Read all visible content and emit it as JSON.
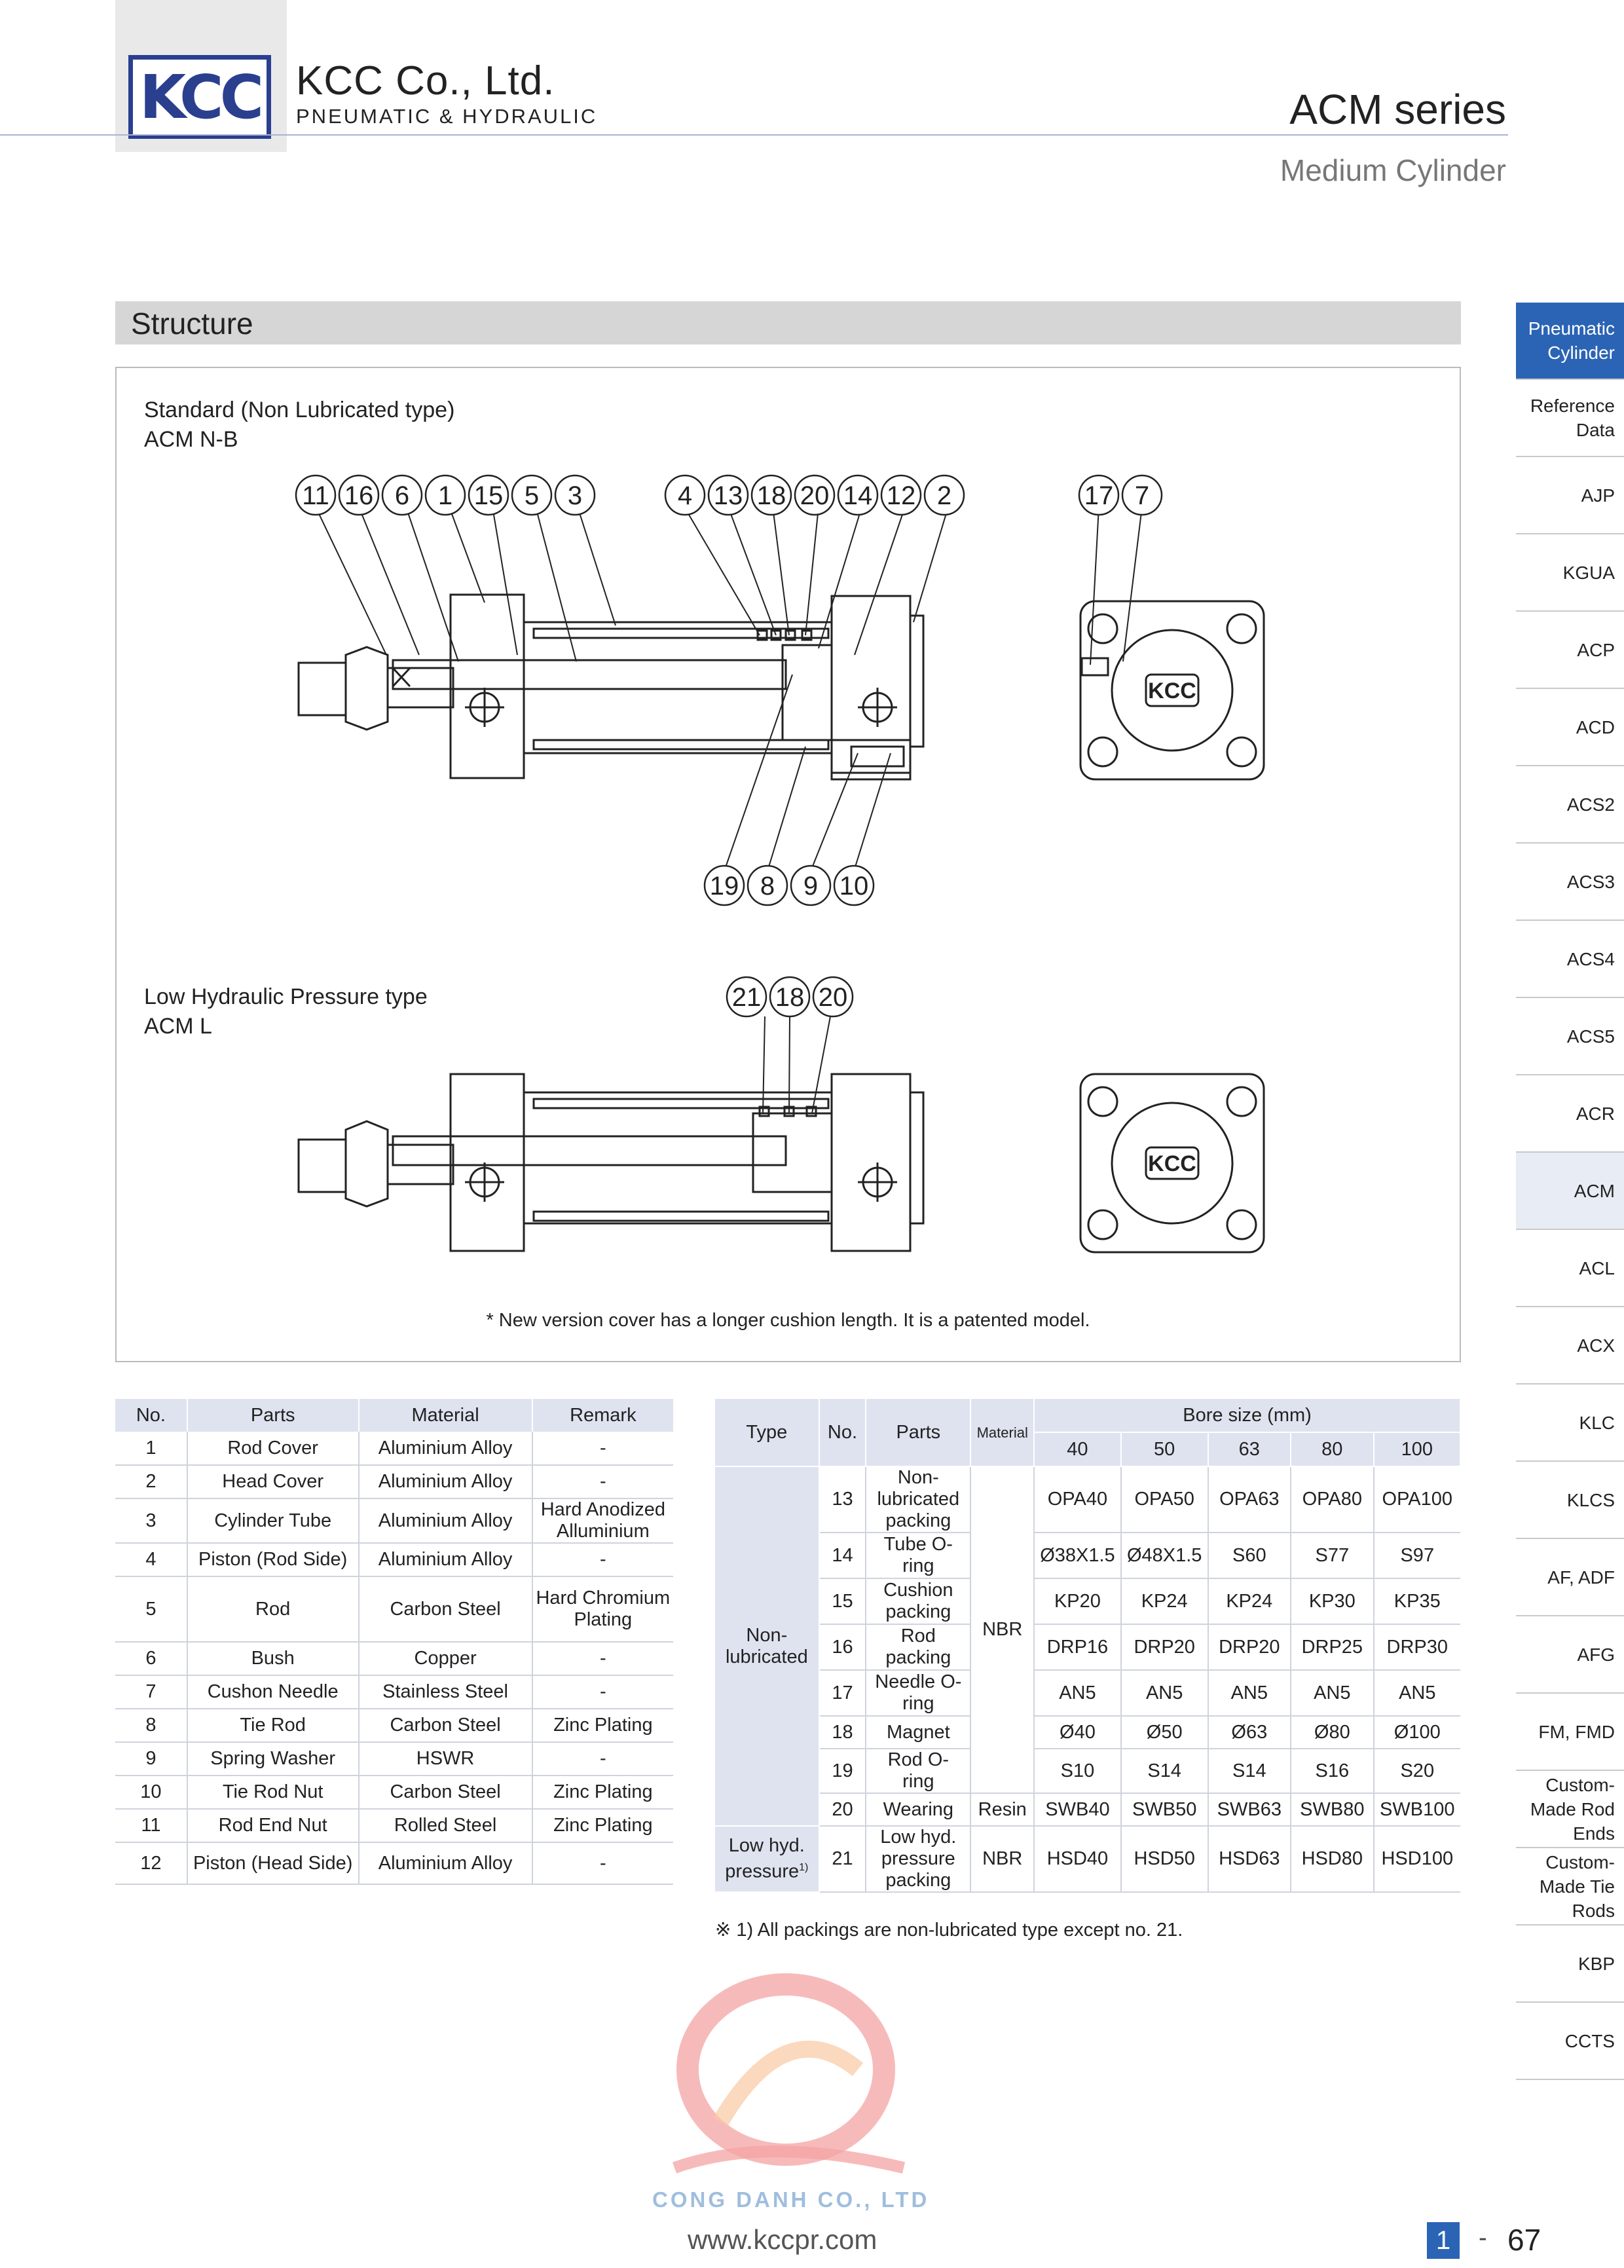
{
  "header": {
    "logo_text": "KCC",
    "company": "KCC Co., Ltd.",
    "company_sub": "PNEUMATIC & HYDRAULIC",
    "series": "ACM series",
    "series_sub": "Medium Cylinder"
  },
  "section": {
    "title": "Structure"
  },
  "structure": {
    "standard_caption_1": "Standard (Non Lubricated type)",
    "standard_caption_2": "ACM N-B",
    "top_callouts_a": [
      "11",
      "16",
      "6",
      "1",
      "15",
      "5",
      "3"
    ],
    "top_callouts_b": [
      "4",
      "13",
      "18",
      "20",
      "14",
      "12",
      "2"
    ],
    "end_callouts": [
      "17",
      "7"
    ],
    "bottom_callouts": [
      "19",
      "8",
      "9",
      "10"
    ],
    "low_caption_1": "Low Hydraulic Pressure type",
    "low_caption_2": "ACM L",
    "low_callouts": [
      "21",
      "18",
      "20"
    ],
    "end_logo": "KCC",
    "note": "* New version cover has a longer cushion length. It is a patented model."
  },
  "parts_table": {
    "headers": [
      "No.",
      "Parts",
      "Material",
      "Remark"
    ],
    "rows": [
      [
        "1",
        "Rod Cover",
        "Aluminium Alloy",
        "-"
      ],
      [
        "2",
        "Head Cover",
        "Aluminium Alloy",
        "-"
      ],
      [
        "3",
        "Cylinder Tube",
        "Aluminium Alloy",
        "Hard Anodized Alluminium"
      ],
      [
        "4",
        "Piston (Rod Side)",
        "Aluminium Alloy",
        "-"
      ],
      [
        "5",
        "Rod",
        "Carbon Steel",
        "Hard Chromium Plating"
      ],
      [
        "6",
        "Bush",
        "Copper",
        "-"
      ],
      [
        "7",
        "Cushon Needle",
        "Stainless Steel",
        "-"
      ],
      [
        "8",
        "Tie Rod",
        "Carbon Steel",
        "Zinc Plating"
      ],
      [
        "9",
        "Spring Washer",
        "HSWR",
        "-"
      ],
      [
        "10",
        "Tie Rod Nut",
        "Carbon Steel",
        "Zinc Plating"
      ],
      [
        "11",
        "Rod End Nut",
        "Rolled Steel",
        "Zinc Plating"
      ],
      [
        "12",
        "Piston (Head Side)",
        "Aluminium Alloy",
        "-"
      ]
    ]
  },
  "seal_table": {
    "h_type": "Type",
    "h_no": "No.",
    "h_parts": "Parts",
    "h_material": "Material",
    "h_bore": "Bore size (mm)",
    "bores": [
      "40",
      "50",
      "63",
      "80",
      "100"
    ],
    "type_nonlub": "Non-lubricated",
    "type_low": "Low hyd. pressure",
    "type_low_sup": "1)",
    "nbr": "NBR",
    "rows": [
      {
        "no": "13",
        "part": "Non-lubricated packing",
        "vals": [
          "OPA40",
          "OPA50",
          "OPA63",
          "OPA80",
          "OPA100"
        ]
      },
      {
        "no": "14",
        "part": "Tube O-ring",
        "vals": [
          "Ø38X1.5",
          "Ø48X1.5",
          "S60",
          "S77",
          "S97"
        ]
      },
      {
        "no": "15",
        "part": "Cushion packing",
        "vals": [
          "KP20",
          "KP24",
          "KP24",
          "KP30",
          "KP35"
        ]
      },
      {
        "no": "16",
        "part": "Rod packing",
        "vals": [
          "DRP16",
          "DRP20",
          "DRP20",
          "DRP25",
          "DRP30"
        ]
      },
      {
        "no": "17",
        "part": "Needle O-ring",
        "vals": [
          "AN5",
          "AN5",
          "AN5",
          "AN5",
          "AN5"
        ]
      },
      {
        "no": "18",
        "part": "Magnet",
        "vals": [
          "Ø40",
          "Ø50",
          "Ø63",
          "Ø80",
          "Ø100"
        ]
      },
      {
        "no": "19",
        "part": "Rod O-ring",
        "vals": [
          "S10",
          "S14",
          "S14",
          "S16",
          "S20"
        ]
      },
      {
        "no": "20",
        "part": "Wearing",
        "material": "Resin",
        "vals": [
          "SWB40",
          "SWB50",
          "SWB63",
          "SWB80",
          "SWB100"
        ]
      },
      {
        "no": "21",
        "part": "Low hyd. pressure packing",
        "material": "NBR",
        "vals": [
          "HSD40",
          "HSD50",
          "HSD63",
          "HSD80",
          "HSD100"
        ]
      }
    ],
    "footnote": "※ 1) All packings are non-lubricated type except no. 21."
  },
  "nav": {
    "items": [
      "Pneumatic Cylinder",
      "Reference Data",
      "AJP",
      "KGUA",
      "ACP",
      "ACD",
      "ACS2",
      "ACS3",
      "ACS4",
      "ACS5",
      "ACR",
      "ACM",
      "ACL",
      "ACX",
      "KLC",
      "KLCS",
      "AF, ADF",
      "AFG",
      "FM, FMD",
      "Custom-Made Rod Ends",
      "Custom-Made Tie Rods",
      "KBP",
      "CCTS"
    ],
    "active": "Pneumatic Cylinder",
    "current": "ACM"
  },
  "footer": {
    "watermark": "CONG DANH CO., LTD",
    "url": "www.kccpr.com",
    "section_no": "1",
    "dash": "-",
    "page": "67"
  },
  "colors": {
    "brand_blue": "#2b3f8f",
    "nav_active": "#2b64b4",
    "table_header": "#dfe3ef"
  }
}
